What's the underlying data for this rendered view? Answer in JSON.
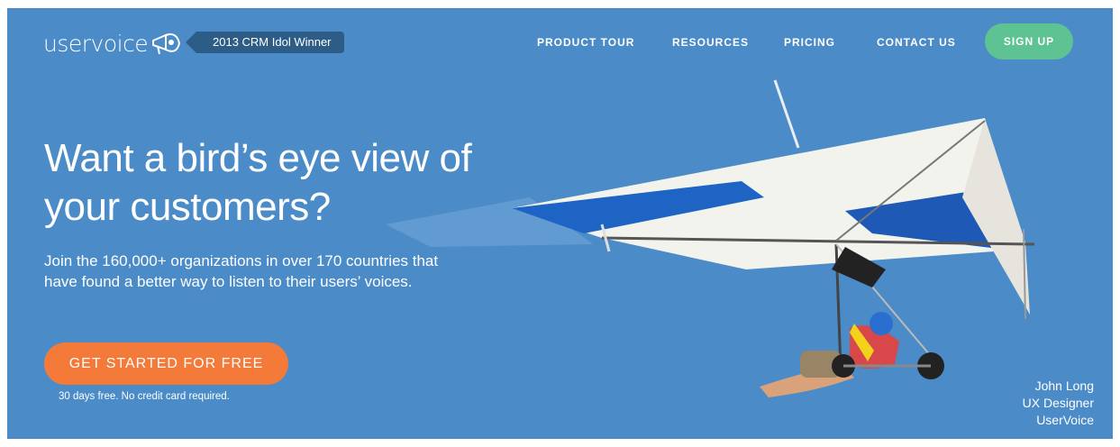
{
  "header": {
    "logo_text": "uservoice",
    "badge": "2013 CRM Idol Winner"
  },
  "nav": {
    "items": [
      {
        "label": "PRODUCT TOUR"
      },
      {
        "label": "RESOURCES"
      },
      {
        "label": "PRICING"
      },
      {
        "label": "CONTACT US"
      }
    ],
    "signup_label": "SIGN UP"
  },
  "hero": {
    "headline": "Want a bird’s eye view of your customers?",
    "subtext": "Join the 160,000+ organizations in over 170 countries that have found a better way to listen to their users’ voices.",
    "cta_label": "GET STARTED FOR FREE",
    "cta_note": "30 days free. No credit card required.",
    "testimonial": {
      "name": "John Long",
      "role": "UX Designer",
      "company": "UserVoice"
    }
  },
  "colors": {
    "background": "#4a8bc8",
    "signup": "#5ec393",
    "cta": "#f47a3a",
    "badge": "#2d5c86"
  }
}
